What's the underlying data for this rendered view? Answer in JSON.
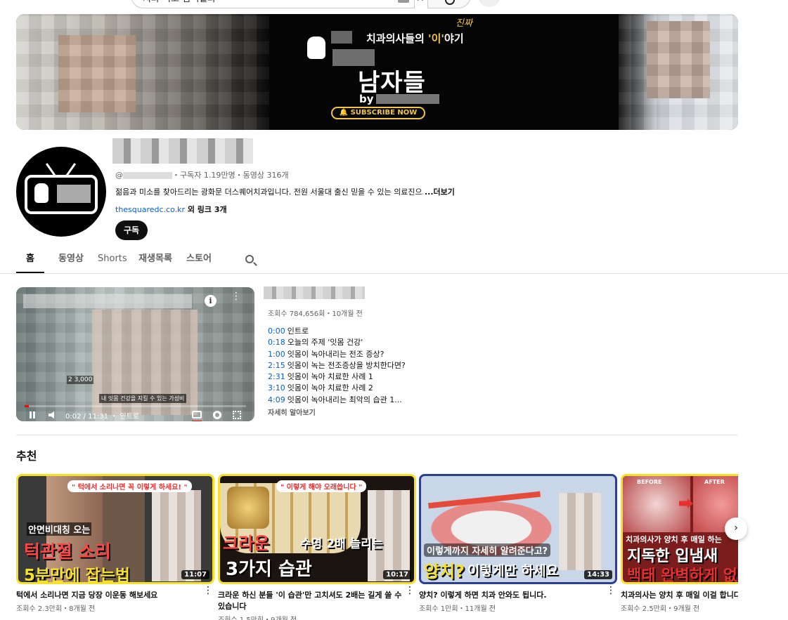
{
  "search": {
    "value": "치과 미소 검색결과"
  },
  "banner": {
    "tagline_a": "치과의사들의 ",
    "tagline_hl": "'이'",
    "tagline_b": "야기",
    "tagline_top": "진짜",
    "title": "남자들",
    "by": "by",
    "subscribe": "🔔 SUBSCRIBE NOW"
  },
  "channel": {
    "meta": "・구독자 1.19만명・동영상 316개",
    "description": "젊음과 미소를 찾아드리는 광화문 더스퀘어치과입니다. 전원 서울대 출신 믿을 수 있는 의료진으로 진료합니다",
    "description_more": "...더보기",
    "link_url": "thesquaredc.co.kr",
    "link_more": " 외 링크 3개",
    "subscribe_label": "구독"
  },
  "tabs": [
    {
      "label": "홈"
    },
    {
      "label": "동영상"
    },
    {
      "label": "Shorts"
    },
    {
      "label": "재생목록"
    },
    {
      "label": "스토어"
    }
  ],
  "featured": {
    "meta": "조회수 784,656회・10개월 전",
    "player_time": "0:02 / 11:31 ・ 인트로",
    "player_count": "2 3,000",
    "player_caption": "내 잇몸 건강을 지킬 수 있는 가성비",
    "progress": 0.003,
    "chapters": [
      {
        "ts": "0:00",
        "label": "인트로"
      },
      {
        "ts": "0:18",
        "label": "오늘의 주제 '잇몸 건강'"
      },
      {
        "ts": "1:00",
        "label": "잇몸이 녹아내리는 전조 증상?"
      },
      {
        "ts": "2:15",
        "label": "잇몸이 녹는 전조증상을 방치한다면?"
      },
      {
        "ts": "2:31",
        "label": "잇몸이 녹아 치료한 사례 1"
      },
      {
        "ts": "3:10",
        "label": "잇몸이 녹아 치료한 사례 2"
      },
      {
        "ts": "4:09",
        "label": "잇몸이 녹아내리는 최악의 습관 1..."
      }
    ],
    "more": "자세히 알아보기"
  },
  "section": {
    "title": "추천"
  },
  "videos": [
    {
      "title": "턱에서 소리나면 지금 당장 이운동 해보세요",
      "meta": "조회수 2.3만회・8개월 전",
      "duration": "11:07",
      "thumb": {
        "tag": "\" 턱에서 소리나면 꼭 이렇게 하세요! \"",
        "l1": "안면비대칭 오는",
        "l2": "턱관절 소리",
        "l3": "5분만에 잡는법"
      }
    },
    {
      "title": "크라운 하신 분들 '이 습관'만 고치셔도 2배는 길게 쓸 수 있습니다",
      "meta": "조회수 1.5만회・9개월 전",
      "duration": "10:17",
      "thumb": {
        "tag": "\" 이렇게 해야 오래씁니다 \"",
        "l1": "크라운",
        "l1b": "수명 2배 늘리는",
        "l2": "3가지 습관"
      }
    },
    {
      "title": "양치? 이렇게 하면 치과 안와도 됩니다.",
      "meta": "조회수 1만회・11개월 전",
      "duration": "14:33",
      "thumb": {
        "q": "이렇게까지 자세히 알려준다고?",
        "l1": "양치?",
        "l1b": "이렇게만 하세요"
      }
    },
    {
      "title": "치과의사는 양치 후 매일 이걸 합니다 없애는 방법",
      "meta": "조회수 2.5만회・9개월 전",
      "duration": "",
      "thumb": {
        "cap1": "BEFORE",
        "cap2": "AFTER",
        "q": "치과의사가 양치 후 매일 하는",
        "l1": "지독한 입냄새",
        "l2": "백태 완벽하게 없"
      }
    }
  ],
  "colors": {
    "accent": "#065fd4",
    "progress": "#ff0000",
    "highlight": "#f5e12a"
  }
}
